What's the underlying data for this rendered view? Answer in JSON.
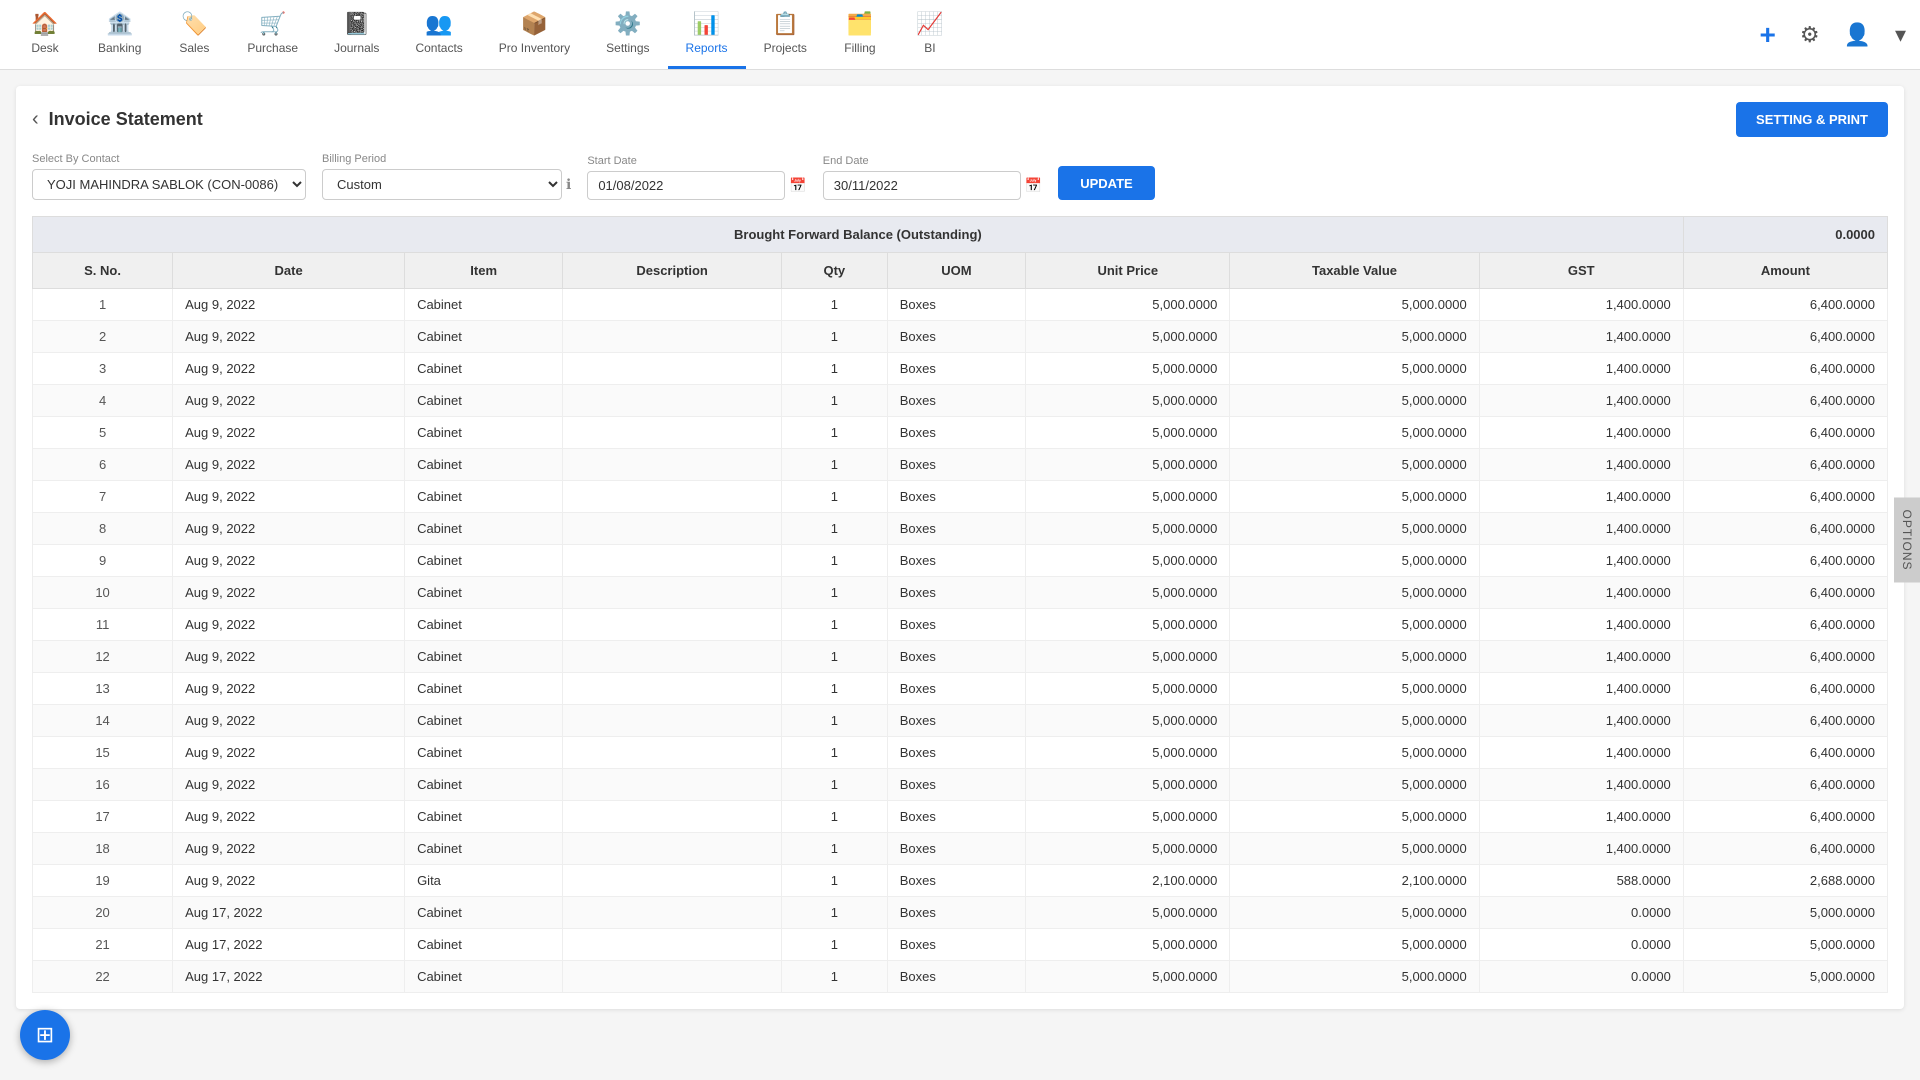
{
  "nav": {
    "items": [
      {
        "id": "desk",
        "label": "Desk",
        "icon": "🏠",
        "active": false
      },
      {
        "id": "banking",
        "label": "Banking",
        "icon": "🏦",
        "active": false
      },
      {
        "id": "sales",
        "label": "Sales",
        "icon": "🏷️",
        "active": false
      },
      {
        "id": "purchase",
        "label": "Purchase",
        "icon": "🛒",
        "active": false
      },
      {
        "id": "journals",
        "label": "Journals",
        "icon": "📓",
        "active": false
      },
      {
        "id": "contacts",
        "label": "Contacts",
        "icon": "👥",
        "active": false
      },
      {
        "id": "pro-inventory",
        "label": "Pro Inventory",
        "icon": "📦",
        "active": false
      },
      {
        "id": "settings",
        "label": "Settings",
        "icon": "⚙️",
        "active": false
      },
      {
        "id": "reports",
        "label": "Reports",
        "icon": "📊",
        "active": true
      },
      {
        "id": "projects",
        "label": "Projects",
        "icon": "📋",
        "active": false
      },
      {
        "id": "filling",
        "label": "Filling",
        "icon": "🗂️",
        "active": false
      },
      {
        "id": "bi",
        "label": "BI",
        "icon": "📈",
        "active": false
      }
    ],
    "add_icon": "+",
    "settings_icon": "⚙",
    "user_icon": "👤",
    "dropdown_icon": "▾"
  },
  "page": {
    "title": "Invoice Statement",
    "back_label": "‹",
    "setting_print_label": "SETTING & PRINT",
    "options_tab_label": "OPTIONS"
  },
  "filters": {
    "select_by_contact_label": "Select By Contact",
    "select_by_contact_value": "YOJI MAHINDRA SABLOK (CON-0086)",
    "billing_period_label": "Billing Period",
    "billing_period_value": "Custom",
    "start_date_label": "Start Date",
    "start_date_value": "01/08/2022",
    "end_date_label": "End Date",
    "end_date_value": "30/11/2022",
    "update_label": "UPDATE"
  },
  "table": {
    "brought_forward_label": "Brought Forward Balance (Outstanding)",
    "brought_forward_amount": "0.0000",
    "columns": [
      "S. No.",
      "Date",
      "Item",
      "Description",
      "Qty",
      "UOM",
      "Unit Price",
      "Taxable Value",
      "GST",
      "Amount"
    ],
    "rows": [
      {
        "sno": 1,
        "date": "Aug 9, 2022",
        "item": "Cabinet",
        "desc": "",
        "qty": 1,
        "uom": "Boxes",
        "unit_price": "5,000.0000",
        "taxable_value": "5,000.0000",
        "gst": "1,400.0000",
        "amount": "6,400.0000"
      },
      {
        "sno": 2,
        "date": "Aug 9, 2022",
        "item": "Cabinet",
        "desc": "",
        "qty": 1,
        "uom": "Boxes",
        "unit_price": "5,000.0000",
        "taxable_value": "5,000.0000",
        "gst": "1,400.0000",
        "amount": "6,400.0000"
      },
      {
        "sno": 3,
        "date": "Aug 9, 2022",
        "item": "Cabinet",
        "desc": "",
        "qty": 1,
        "uom": "Boxes",
        "unit_price": "5,000.0000",
        "taxable_value": "5,000.0000",
        "gst": "1,400.0000",
        "amount": "6,400.0000"
      },
      {
        "sno": 4,
        "date": "Aug 9, 2022",
        "item": "Cabinet",
        "desc": "",
        "qty": 1,
        "uom": "Boxes",
        "unit_price": "5,000.0000",
        "taxable_value": "5,000.0000",
        "gst": "1,400.0000",
        "amount": "6,400.0000"
      },
      {
        "sno": 5,
        "date": "Aug 9, 2022",
        "item": "Cabinet",
        "desc": "",
        "qty": 1,
        "uom": "Boxes",
        "unit_price": "5,000.0000",
        "taxable_value": "5,000.0000",
        "gst": "1,400.0000",
        "amount": "6,400.0000"
      },
      {
        "sno": 6,
        "date": "Aug 9, 2022",
        "item": "Cabinet",
        "desc": "",
        "qty": 1,
        "uom": "Boxes",
        "unit_price": "5,000.0000",
        "taxable_value": "5,000.0000",
        "gst": "1,400.0000",
        "amount": "6,400.0000"
      },
      {
        "sno": 7,
        "date": "Aug 9, 2022",
        "item": "Cabinet",
        "desc": "",
        "qty": 1,
        "uom": "Boxes",
        "unit_price": "5,000.0000",
        "taxable_value": "5,000.0000",
        "gst": "1,400.0000",
        "amount": "6,400.0000"
      },
      {
        "sno": 8,
        "date": "Aug 9, 2022",
        "item": "Cabinet",
        "desc": "",
        "qty": 1,
        "uom": "Boxes",
        "unit_price": "5,000.0000",
        "taxable_value": "5,000.0000",
        "gst": "1,400.0000",
        "amount": "6,400.0000"
      },
      {
        "sno": 9,
        "date": "Aug 9, 2022",
        "item": "Cabinet",
        "desc": "",
        "qty": 1,
        "uom": "Boxes",
        "unit_price": "5,000.0000",
        "taxable_value": "5,000.0000",
        "gst": "1,400.0000",
        "amount": "6,400.0000"
      },
      {
        "sno": 10,
        "date": "Aug 9, 2022",
        "item": "Cabinet",
        "desc": "",
        "qty": 1,
        "uom": "Boxes",
        "unit_price": "5,000.0000",
        "taxable_value": "5,000.0000",
        "gst": "1,400.0000",
        "amount": "6,400.0000"
      },
      {
        "sno": 11,
        "date": "Aug 9, 2022",
        "item": "Cabinet",
        "desc": "",
        "qty": 1,
        "uom": "Boxes",
        "unit_price": "5,000.0000",
        "taxable_value": "5,000.0000",
        "gst": "1,400.0000",
        "amount": "6,400.0000"
      },
      {
        "sno": 12,
        "date": "Aug 9, 2022",
        "item": "Cabinet",
        "desc": "",
        "qty": 1,
        "uom": "Boxes",
        "unit_price": "5,000.0000",
        "taxable_value": "5,000.0000",
        "gst": "1,400.0000",
        "amount": "6,400.0000"
      },
      {
        "sno": 13,
        "date": "Aug 9, 2022",
        "item": "Cabinet",
        "desc": "",
        "qty": 1,
        "uom": "Boxes",
        "unit_price": "5,000.0000",
        "taxable_value": "5,000.0000",
        "gst": "1,400.0000",
        "amount": "6,400.0000"
      },
      {
        "sno": 14,
        "date": "Aug 9, 2022",
        "item": "Cabinet",
        "desc": "",
        "qty": 1,
        "uom": "Boxes",
        "unit_price": "5,000.0000",
        "taxable_value": "5,000.0000",
        "gst": "1,400.0000",
        "amount": "6,400.0000"
      },
      {
        "sno": 15,
        "date": "Aug 9, 2022",
        "item": "Cabinet",
        "desc": "",
        "qty": 1,
        "uom": "Boxes",
        "unit_price": "5,000.0000",
        "taxable_value": "5,000.0000",
        "gst": "1,400.0000",
        "amount": "6,400.0000"
      },
      {
        "sno": 16,
        "date": "Aug 9, 2022",
        "item": "Cabinet",
        "desc": "",
        "qty": 1,
        "uom": "Boxes",
        "unit_price": "5,000.0000",
        "taxable_value": "5,000.0000",
        "gst": "1,400.0000",
        "amount": "6,400.0000"
      },
      {
        "sno": 17,
        "date": "Aug 9, 2022",
        "item": "Cabinet",
        "desc": "",
        "qty": 1,
        "uom": "Boxes",
        "unit_price": "5,000.0000",
        "taxable_value": "5,000.0000",
        "gst": "1,400.0000",
        "amount": "6,400.0000"
      },
      {
        "sno": 18,
        "date": "Aug 9, 2022",
        "item": "Cabinet",
        "desc": "",
        "qty": 1,
        "uom": "Boxes",
        "unit_price": "5,000.0000",
        "taxable_value": "5,000.0000",
        "gst": "1,400.0000",
        "amount": "6,400.0000"
      },
      {
        "sno": 19,
        "date": "Aug 9, 2022",
        "item": "Gita",
        "desc": "",
        "qty": 1,
        "uom": "Boxes",
        "unit_price": "2,100.0000",
        "taxable_value": "2,100.0000",
        "gst": "588.0000",
        "amount": "2,688.0000"
      },
      {
        "sno": 20,
        "date": "Aug 17, 2022",
        "item": "Cabinet",
        "desc": "",
        "qty": 1,
        "uom": "Boxes",
        "unit_price": "5,000.0000",
        "taxable_value": "5,000.0000",
        "gst": "0.0000",
        "amount": "5,000.0000"
      },
      {
        "sno": 21,
        "date": "Aug 17, 2022",
        "item": "Cabinet",
        "desc": "",
        "qty": 1,
        "uom": "Boxes",
        "unit_price": "5,000.0000",
        "taxable_value": "5,000.0000",
        "gst": "0.0000",
        "amount": "5,000.0000"
      },
      {
        "sno": 22,
        "date": "Aug 17, 2022",
        "item": "Cabinet",
        "desc": "",
        "qty": 1,
        "uom": "Boxes",
        "unit_price": "5,000.0000",
        "taxable_value": "5,000.0000",
        "gst": "0.0000",
        "amount": "5,000.0000"
      }
    ]
  }
}
